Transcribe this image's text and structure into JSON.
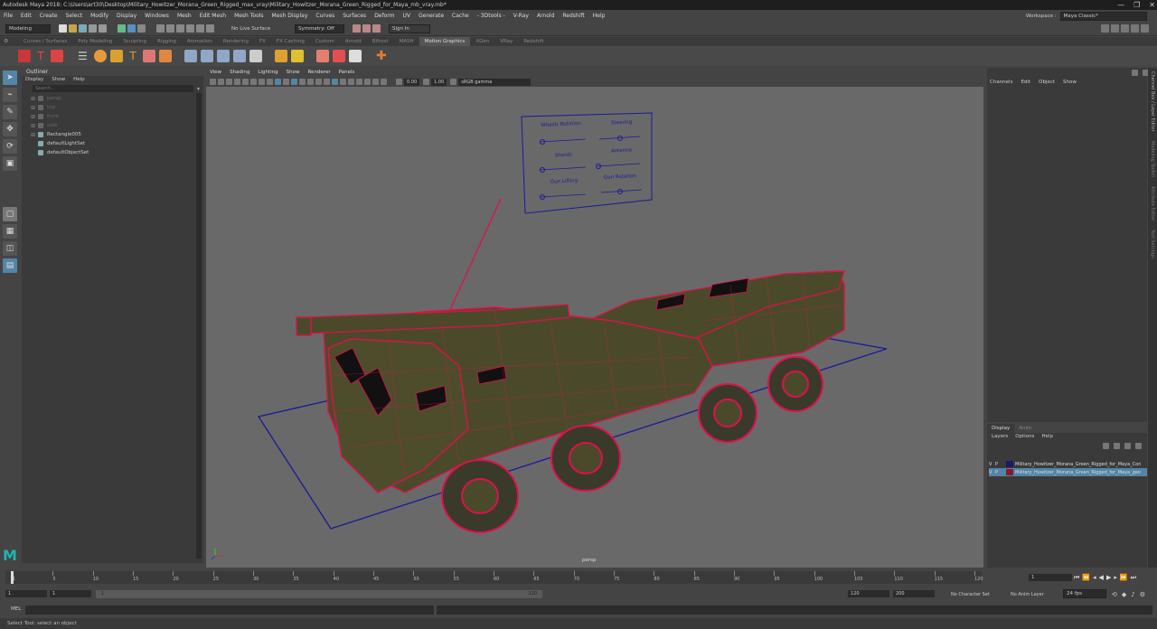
{
  "window": {
    "title": "Autodesk Maya 2018: C:\\Users\\art30\\Desktop\\Military_Howitzer_Morana_Green_Rigged_max_vray\\Military_Howitzer_Morana_Green_Rigged_for_Maya_mb_vray.mb*",
    "controls": [
      "—",
      "❐",
      "✕"
    ]
  },
  "menubar": [
    "File",
    "Edit",
    "Create",
    "Select",
    "Modify",
    "Display",
    "Windows",
    "Mesh",
    "Edit Mesh",
    "Mesh Tools",
    "Mesh Display",
    "Curves",
    "Surfaces",
    "Deform",
    "UV",
    "Generate",
    "Cache",
    "- 3Dtools -",
    "V-Ray",
    "Arnold",
    "Redshift",
    "Help"
  ],
  "workspace": {
    "label": "Workspace :",
    "value": "Maya Classic*"
  },
  "statusline": {
    "mode": "Modeling",
    "live_surface": "No Live Surface",
    "symmetry": "Symmetry: Off",
    "signin": "Sign In"
  },
  "shelf_tabs": [
    "Curves / Surfaces",
    "Poly Modeling",
    "Sculpting",
    "Rigging",
    "Animation",
    "Rendering",
    "FX",
    "FX Caching",
    "Custom",
    "Arnold",
    "Bifrost",
    "MASH",
    "Motion Graphics",
    "XGen",
    "VRay",
    "Redshift"
  ],
  "shelf_active": "Motion Graphics",
  "outliner": {
    "title": "Outliner",
    "menu": [
      "Display",
      "Show",
      "Help"
    ],
    "search_placeholder": "Search...",
    "items": [
      {
        "label": "persp",
        "dim": true
      },
      {
        "label": "top",
        "dim": true
      },
      {
        "label": "front",
        "dim": true
      },
      {
        "label": "side",
        "dim": true
      },
      {
        "label": "Rectangle005",
        "dim": false
      },
      {
        "label": "defaultLightSet",
        "dim": false
      },
      {
        "label": "defaultObjectSet",
        "dim": false
      }
    ]
  },
  "viewport": {
    "menu": [
      "View",
      "Shading",
      "Lighting",
      "Show",
      "Renderer",
      "Panels"
    ],
    "field_a": "0.00",
    "field_b": "1.00",
    "colorspace": "sRGB gamma",
    "camera_label": "persp",
    "control_panel": {
      "labels": [
        "Wheels Rotation",
        "Steering",
        "Stands",
        "Antenna",
        "Gun Lifting",
        "Gun Rotation"
      ]
    }
  },
  "channelbox": {
    "menu": [
      "Channels",
      "Edit",
      "Object",
      "Show"
    ],
    "side_tabs": [
      "Channel Box / Layer Editor",
      "Modeling Toolkit",
      "Attribute Editor",
      "Tool Settings"
    ]
  },
  "layers": {
    "tabs": [
      "Display",
      "Anim"
    ],
    "menu": [
      "Layers",
      "Options",
      "Help"
    ],
    "rows": [
      {
        "v": "V",
        "p": "P",
        "color": "#1a1a6a",
        "name": "Military_Howitzer_Morana_Green_Rigged_for_Maya_Con",
        "selected": false
      },
      {
        "v": "V",
        "p": "P",
        "color": "#8a1a2a",
        "name": "Military_Howitzer_Morana_Green_Rigged_for_Maya_geo",
        "selected": true
      }
    ]
  },
  "timeline": {
    "ticks": [
      "1",
      "5",
      "10",
      "15",
      "20",
      "25",
      "30",
      "35",
      "40",
      "45",
      "50",
      "55",
      "60",
      "65",
      "70",
      "75",
      "80",
      "85",
      "90",
      "95",
      "100",
      "105",
      "110",
      "115",
      "120"
    ],
    "current_frame": "1"
  },
  "range": {
    "start": "1",
    "start2": "1",
    "range_start_label": "1",
    "range_end_label": "120",
    "end": "120",
    "end2": "200",
    "character_set": "No Character Set",
    "anim_layer": "No Anim Layer",
    "fps": "24 fps"
  },
  "cmdline": {
    "label": "MEL"
  },
  "helpline": "Select Tool: select an object",
  "colors": {
    "wire_red": "#e0104a",
    "body_green": "#4a4a2a",
    "grid_blue": "#1a1a9a",
    "maya_logo": "#1fb5ad"
  }
}
